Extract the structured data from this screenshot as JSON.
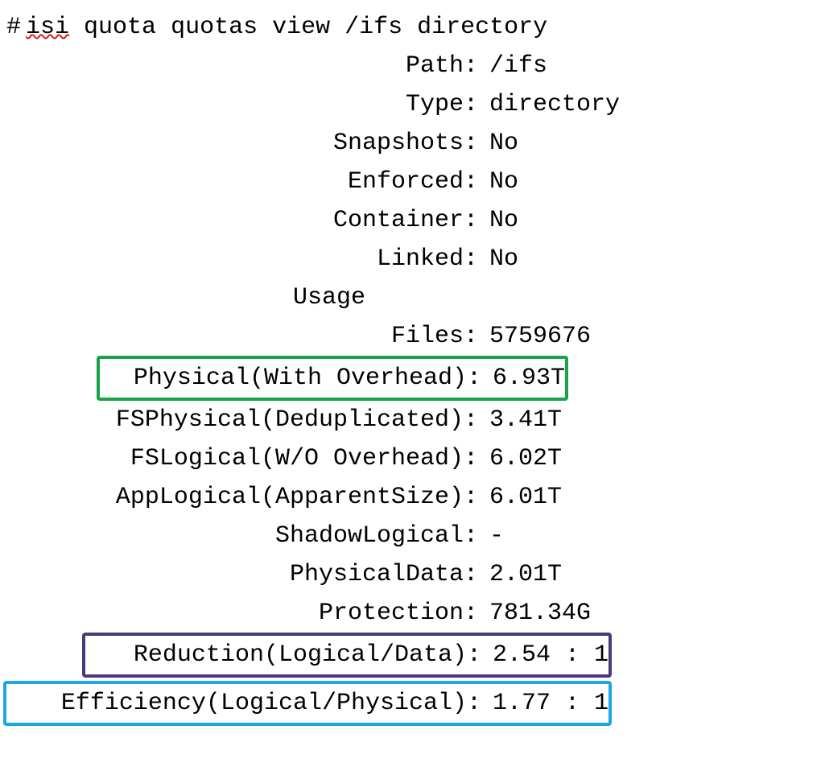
{
  "prompt": {
    "hash": "#",
    "squiggly": "isi",
    "rest": "quota quotas view /ifs directory"
  },
  "rows": {
    "path": {
      "label": "Path:",
      "value": "/ifs"
    },
    "type": {
      "label": "Type:",
      "value": "directory"
    },
    "snapshots": {
      "label": "Snapshots:",
      "value": "No"
    },
    "enforced": {
      "label": "Enforced:",
      "value": "No"
    },
    "container": {
      "label": "Container:",
      "value": "No"
    },
    "linked": {
      "label": "Linked:",
      "value": "No"
    },
    "usage": {
      "label": "Usage"
    },
    "files": {
      "label": "Files:",
      "value": "5759676"
    },
    "physical": {
      "label": "Physical(With Overhead):",
      "value": "6.93T"
    },
    "fsphysical": {
      "label": "FSPhysical(Deduplicated):",
      "value": "3.41T"
    },
    "fslogical": {
      "label": "FSLogical(W/O Overhead):",
      "value": "6.02T"
    },
    "applogical": {
      "label": "AppLogical(ApparentSize):",
      "value": "6.01T"
    },
    "shadowlogical": {
      "label": "ShadowLogical:",
      "value": "-"
    },
    "physicaldata": {
      "label": "PhysicalData:",
      "value": "2.01T"
    },
    "protection": {
      "label": "Protection:",
      "value": "781.34G"
    },
    "reduction": {
      "label": "Reduction(Logical/Data):",
      "value": "2.54 : 1"
    },
    "efficiency": {
      "label": "Efficiency(Logical/Physical):",
      "value": "1.77 : 1"
    }
  }
}
